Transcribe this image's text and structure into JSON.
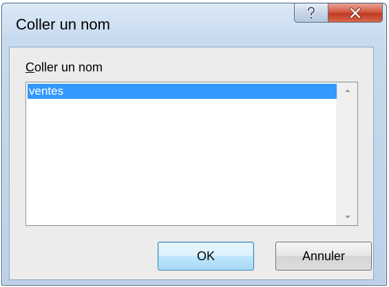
{
  "dialog": {
    "title": "Coller un nom",
    "help_glyph": "?",
    "close_glyph": "X"
  },
  "field": {
    "label_accel": "C",
    "label_rest": "oller un nom"
  },
  "list": {
    "items": [
      "ventes"
    ],
    "selected_index": 0
  },
  "buttons": {
    "ok_label": "OK",
    "cancel_label": "Annuler"
  },
  "icons": {
    "help": "question-icon",
    "close": "close-icon",
    "scroll_up": "arrow-up-icon",
    "scroll_down": "arrow-down-icon"
  },
  "colors": {
    "selection": "#3399ff",
    "close_button": "#c9452b",
    "default_button_border": "#3c7fb1"
  }
}
